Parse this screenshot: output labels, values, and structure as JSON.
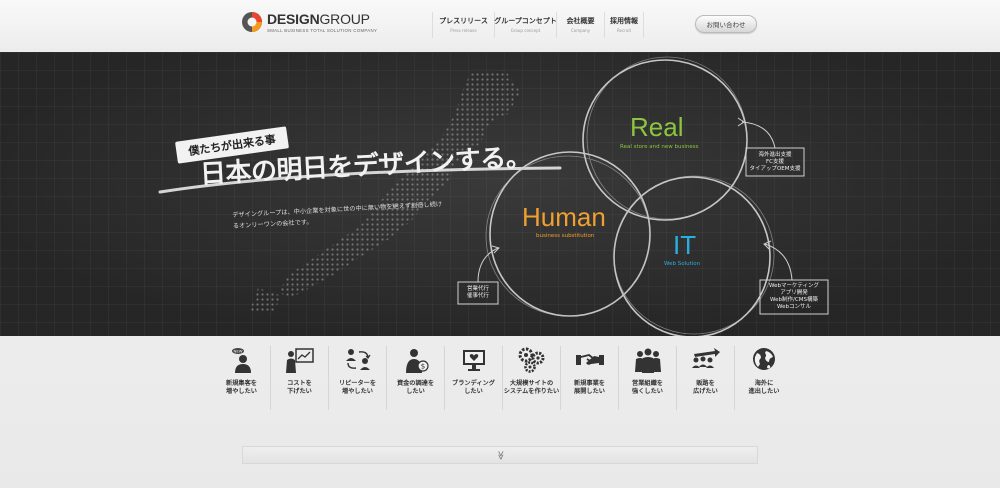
{
  "brand": {
    "name_bold": "DESIGN",
    "name_light": "GROUP",
    "tagline": "SMALL BUSINESS TOTAL SOLUTION COMPANY",
    "logo_colors": [
      "#e8462e",
      "#f39a1e",
      "#555555"
    ]
  },
  "nav": {
    "items": [
      {
        "ja": "プレスリリース",
        "en": "Press release"
      },
      {
        "ja": "グループコンセプト",
        "en": "Group concept"
      },
      {
        "ja": "会社概要",
        "en": "Company"
      },
      {
        "ja": "採用情報",
        "en": "Recruit"
      }
    ],
    "contact_label": "お問い合わせ"
  },
  "hero": {
    "badge": "僕たちが出来る事",
    "headline": "日本の明日をデザインする。",
    "description": "デザイングループは、中小企業を対象に世の中に無い物を絶えず創造し続けるオンリーワンの会社です。",
    "circles": [
      {
        "title": "Real",
        "subtitle": "Real store and new business",
        "color": "#8cc63f"
      },
      {
        "title": "Human",
        "subtitle": "business substitution",
        "color": "#f0a030"
      },
      {
        "title": "IT",
        "subtitle": "Web Solution",
        "color": "#29aee0"
      }
    ],
    "notes": {
      "real": [
        "海外進出支援",
        "FC支援",
        "タイアップOEM支援"
      ],
      "human": [
        "営業代行",
        "催事代行"
      ],
      "it": [
        "Webマーケティング",
        "アプリ開発",
        "Web制作/CMS構築",
        "Webコンサル"
      ]
    }
  },
  "services": [
    {
      "label": "新規集客を\n増やしたい",
      "icon": "new-customer-icon",
      "badge": "NEW"
    },
    {
      "label": "コストを\n下げたい",
      "icon": "presentation-chart-icon"
    },
    {
      "label": "リピーターを\n増やしたい",
      "icon": "repeat-users-icon"
    },
    {
      "label": "資金の調達を\nしたい",
      "icon": "money-person-icon"
    },
    {
      "label": "ブランディング\nしたい",
      "icon": "monitor-heart-icon"
    },
    {
      "label": "大規模サイトの\nシステムを作りたい",
      "icon": "gears-icon"
    },
    {
      "label": "新規事業を\n展開したい",
      "icon": "handshake-icon"
    },
    {
      "label": "営業組織を\n強くしたい",
      "icon": "team-icon"
    },
    {
      "label": "販路を\n広げたい",
      "icon": "sales-channel-icon"
    },
    {
      "label": "海外に\n進出したい",
      "icon": "globe-icon"
    }
  ],
  "more": {
    "label": "≫",
    "icon": "double-chevron-down-icon"
  }
}
